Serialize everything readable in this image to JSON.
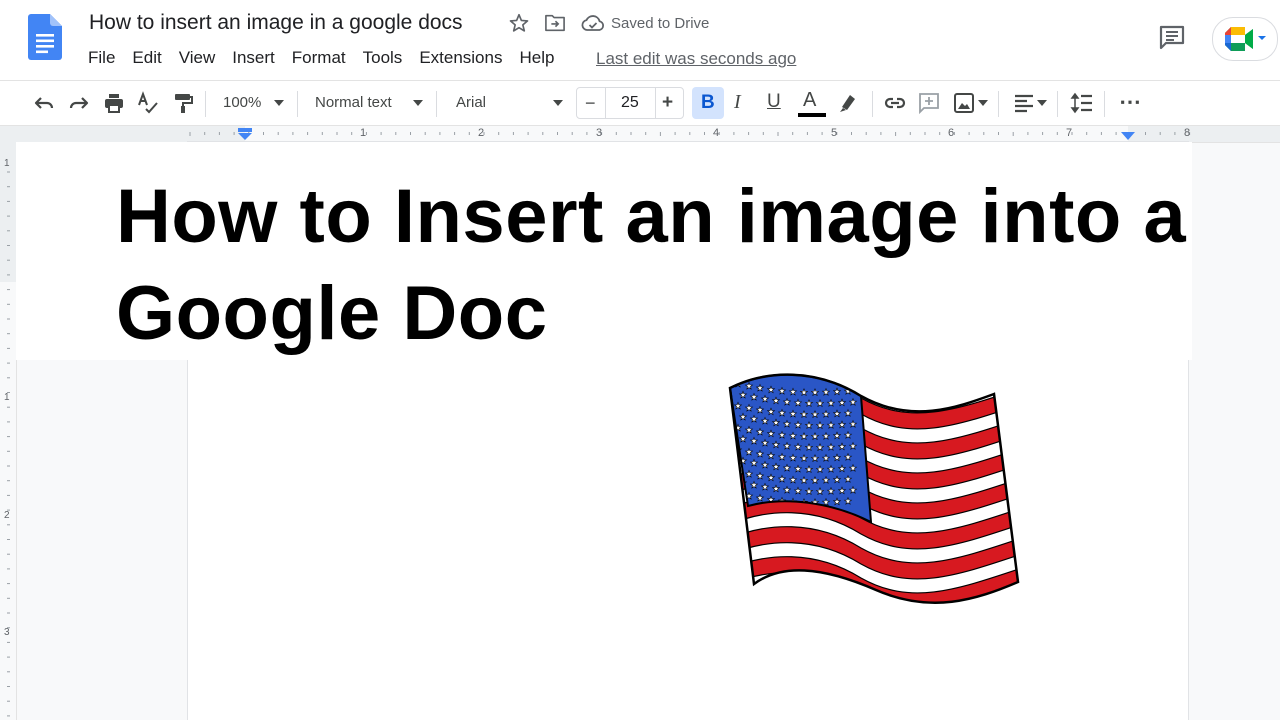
{
  "header": {
    "title": "How to insert an image in a google docs",
    "save_status": "Saved to Drive",
    "last_edit": "Last edit was seconds ago",
    "menu": [
      "File",
      "Edit",
      "View",
      "Insert",
      "Format",
      "Tools",
      "Extensions",
      "Help"
    ]
  },
  "toolbar": {
    "zoom": "100%",
    "style": "Normal text",
    "font": "Arial",
    "font_size": "25",
    "minus": "−",
    "plus": "+",
    "bold": "B",
    "italic": "I",
    "underline": "U",
    "text_color": "A",
    "more": "⋯"
  },
  "ruler": {
    "top_numbers": [
      "1",
      "2",
      "3",
      "4",
      "5",
      "6",
      "7",
      "8"
    ],
    "left_numbers": [
      "1",
      "1",
      "2",
      "3"
    ]
  },
  "document": {
    "heading": "How to Insert an image into a Google Doc"
  },
  "colors": {
    "accent_blue": "#1a73e8",
    "bold_highlight": "#d3e3fd",
    "flag_red": "#d71920",
    "flag_blue": "#2a56c6"
  },
  "icons": [
    "docs-logo-icon",
    "star-icon",
    "move-to-folder-icon",
    "cloud-done-icon",
    "comment-icon",
    "meet-icon",
    "undo-icon",
    "redo-icon",
    "print-icon",
    "spellcheck-icon",
    "paint-format-icon",
    "link-icon",
    "add-comment-icon",
    "insert-image-icon",
    "align-left-icon",
    "line-spacing-icon",
    "more-icon"
  ]
}
